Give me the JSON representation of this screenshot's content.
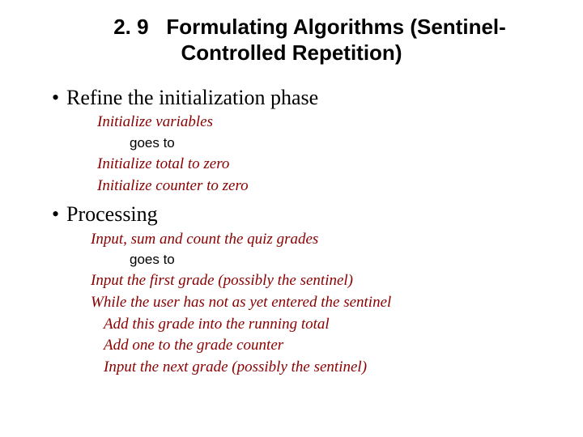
{
  "heading": {
    "section_number": "2. 9",
    "title_line1": "Formulating Algorithms (Sentinel-",
    "title_line2": "Controlled Repetition)"
  },
  "bullets": [
    {
      "text": "Refine the initialization phase",
      "sub": [
        {
          "kind": "pseudo",
          "indent": "a",
          "text": "Initialize variables"
        },
        {
          "kind": "goes",
          "indent": "b",
          "text": "goes to"
        },
        {
          "kind": "pseudo",
          "indent": "a",
          "text": "Initialize total to zero"
        },
        {
          "kind": "pseudo",
          "indent": "a",
          "text": "Initialize counter to zero"
        }
      ]
    },
    {
      "text": "Processing",
      "sub": [
        {
          "kind": "pseudo",
          "indent": "c",
          "text": "Input, sum and count the quiz grades"
        },
        {
          "kind": "goes",
          "indent": "b",
          "text": "goes to"
        },
        {
          "kind": "pseudo",
          "indent": "c",
          "text": "Input the first grade (possibly the sentinel)"
        },
        {
          "kind": "pseudo",
          "indent": "c",
          "text": "While the user has not as yet entered the sentinel"
        },
        {
          "kind": "pseudo",
          "indent": "d",
          "text": "Add this grade into the running total"
        },
        {
          "kind": "pseudo",
          "indent": "d",
          "text": "Add one to the grade counter"
        },
        {
          "kind": "pseudo",
          "indent": "d",
          "text": "Input the next grade (possibly the sentinel)"
        }
      ]
    }
  ]
}
